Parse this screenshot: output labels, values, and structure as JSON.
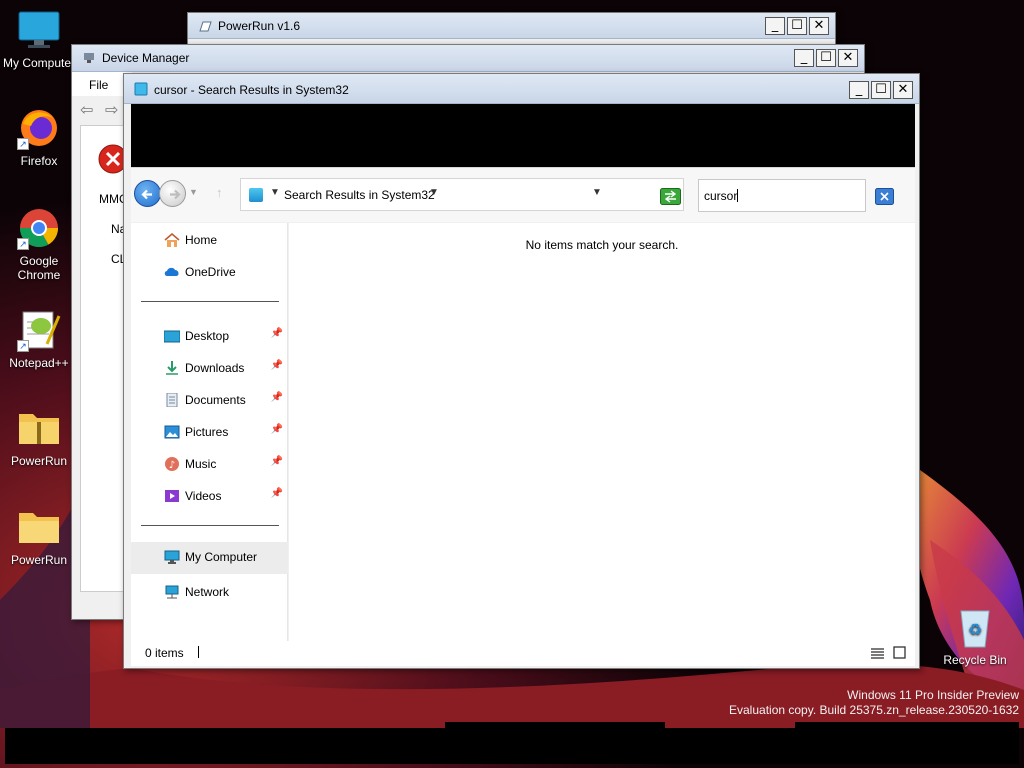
{
  "desktop": {
    "icons": [
      {
        "label": "My Computer",
        "icon": "my-computer-icon"
      },
      {
        "label": "Firefox",
        "icon": "firefox-icon"
      },
      {
        "label": "Google Chrome",
        "icon": "chrome-icon"
      },
      {
        "label": "Notepad++",
        "icon": "notepadpp-icon"
      },
      {
        "label": "PowerRun",
        "icon": "zip-folder-icon"
      },
      {
        "label": "PowerRun",
        "icon": "folder-icon"
      },
      {
        "label": "Recycle Bin",
        "icon": "recycle-bin-icon"
      }
    ],
    "watermark_line1": "Windows 11 Pro Insider Preview",
    "watermark_line2": "Evaluation copy. Build 25375.zn_release.230520-1632"
  },
  "powerrun": {
    "title": "PowerRun v1.6"
  },
  "device_manager": {
    "title": "Device Manager",
    "menu_file": "File",
    "partial_mmc": "MMC",
    "partial_na": "Na",
    "partial_cl": "CL"
  },
  "explorer": {
    "title": "cursor - Search Results in System32",
    "address_text": "Search Results in System32",
    "search_value": "cursor",
    "sidebar": {
      "home": "Home",
      "onedrive": "OneDrive",
      "desktop": "Desktop",
      "downloads": "Downloads",
      "documents": "Documents",
      "pictures": "Pictures",
      "music": "Music",
      "videos": "Videos",
      "my_computer": "My Computer",
      "network": "Network"
    },
    "empty_message": "No items match your search.",
    "status_count": "0 items"
  },
  "window_buttons": {
    "minimize": "_",
    "maximize": "☐",
    "close": "✕"
  },
  "colors": {
    "accent": "#1e6fd0",
    "titlebar": "#d4dfed"
  }
}
